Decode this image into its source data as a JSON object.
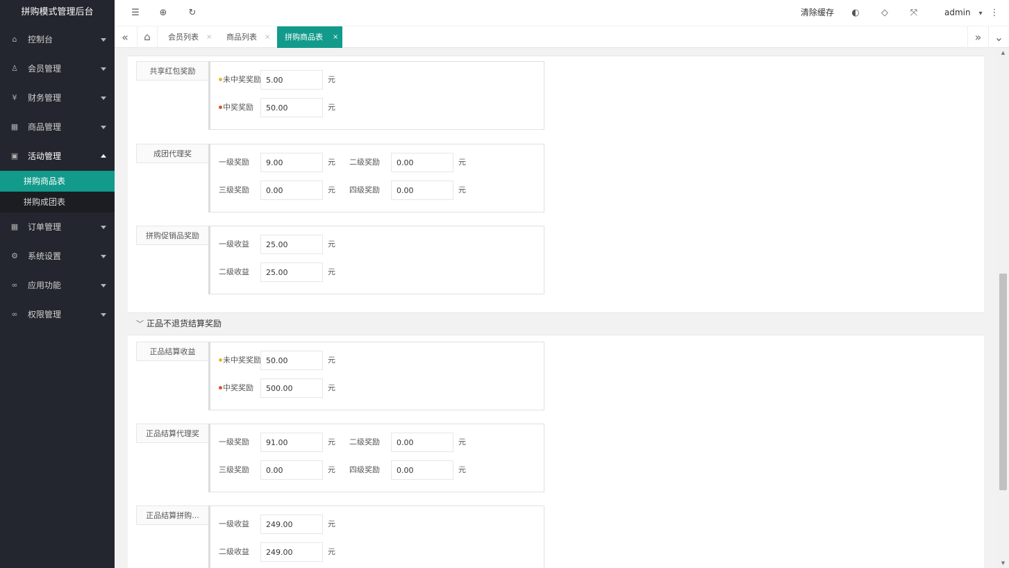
{
  "app": {
    "title": "拼购模式管理后台"
  },
  "sidebar": {
    "items": [
      {
        "label": "控制台",
        "icon": "home-icon",
        "glyph": "⌂"
      },
      {
        "label": "会员管理",
        "icon": "user-icon",
        "glyph": "♙"
      },
      {
        "label": "财务管理",
        "icon": "yen-icon",
        "glyph": "¥"
      },
      {
        "label": "商品管理",
        "icon": "grid-icon",
        "glyph": "▦"
      },
      {
        "label": "活动管理",
        "icon": "gift-icon",
        "glyph": "▣",
        "open": true,
        "children": [
          {
            "label": "拼购商品表",
            "active": true
          },
          {
            "label": "拼购成团表"
          }
        ]
      },
      {
        "label": "订单管理",
        "icon": "order-icon",
        "glyph": "▦"
      },
      {
        "label": "系统设置",
        "icon": "gear-icon",
        "glyph": "⚙"
      },
      {
        "label": "应用功能",
        "icon": "link-icon",
        "glyph": "∞"
      },
      {
        "label": "权限管理",
        "icon": "key-icon",
        "glyph": "∞"
      }
    ]
  },
  "header": {
    "icons": {
      "menu": "☰",
      "globe": "⊕",
      "refresh": "↻",
      "theme": "◐",
      "tag": "◇",
      "fullscreen": "⤧",
      "more": "⋮"
    },
    "clear_cache": "清除缓存",
    "user": "admin",
    "user_caret": "▾"
  },
  "tabs": {
    "prev": "«",
    "next": "»",
    "down": "⌄",
    "home": "⌂",
    "close": "×",
    "items": [
      {
        "label": "会员列表"
      },
      {
        "label": "商品列表"
      },
      {
        "label": "拼购商品表",
        "active": true
      }
    ]
  },
  "form": {
    "unit": "元",
    "chevron": "﹀",
    "section2_title": "正品不退货结算奖励",
    "groups": [
      {
        "label": "共享红包奖励",
        "rows": [
          [
            {
              "label": "未中奖奖励",
              "dot": "#e8b92c",
              "value": "5.00"
            }
          ],
          [
            {
              "label": "中奖奖励",
              "dot": "#d9542a",
              "value": "50.00"
            }
          ]
        ]
      },
      {
        "label": "成团代理奖",
        "rows": [
          [
            {
              "label": "一级奖励",
              "value": "9.00"
            },
            {
              "label": "二级奖励",
              "value": "0.00"
            }
          ],
          [
            {
              "label": "三级奖励",
              "value": "0.00"
            },
            {
              "label": "四级奖励",
              "value": "0.00"
            }
          ]
        ]
      },
      {
        "label": "拼购促销品奖励",
        "rows": [
          [
            {
              "label": "一级收益",
              "value": "25.00"
            }
          ],
          [
            {
              "label": "二级收益",
              "value": "25.00"
            }
          ]
        ]
      },
      {
        "label": "正品结算收益",
        "rows": [
          [
            {
              "label": "未中奖奖励",
              "dot": "#e8b92c",
              "value": "50.00"
            }
          ],
          [
            {
              "label": "中奖奖励",
              "dot": "#d9542a",
              "value": "500.00"
            }
          ]
        ]
      },
      {
        "label": "正品结算代理奖",
        "rows": [
          [
            {
              "label": "一级奖励",
              "value": "91.00"
            },
            {
              "label": "二级奖励",
              "value": "0.00"
            }
          ],
          [
            {
              "label": "三级奖励",
              "value": "0.00"
            },
            {
              "label": "四级奖励",
              "value": "0.00"
            }
          ]
        ]
      },
      {
        "label": "正品结算拼购...",
        "rows": [
          [
            {
              "label": "一级收益",
              "value": "249.00"
            }
          ],
          [
            {
              "label": "二级收益",
              "value": "249.00"
            }
          ]
        ]
      }
    ]
  },
  "scrollbar": {
    "up": "▲",
    "down": "▼"
  }
}
